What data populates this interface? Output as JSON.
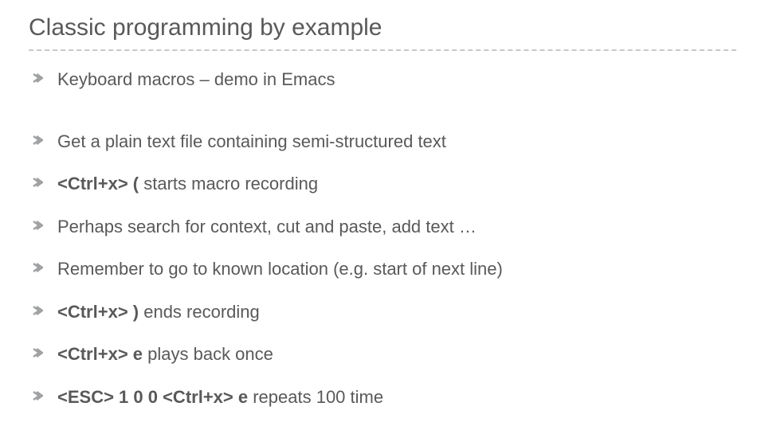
{
  "title": "Classic programming by example",
  "bullets": [
    {
      "html": "Keyboard macros – demo in Emacs"
    },
    {
      "html": "Get a plain text file containing semi-structured text"
    },
    {
      "html": "<b>&lt;Ctrl+x&gt; (</b> starts macro recording"
    },
    {
      "html": "Perhaps search for context, cut and paste, add text …"
    },
    {
      "html": "Remember to go to known location (e.g. start of next line)"
    },
    {
      "html": "<b>&lt;Ctrl+x&gt; )</b> ends recording"
    },
    {
      "html": "<b>&lt;Ctrl+x&gt; e</b> plays back once"
    },
    {
      "html": "<b>&lt;ESC&gt; 1 0 0 &lt;Ctrl+x&gt; e</b> repeats 100 time"
    }
  ]
}
